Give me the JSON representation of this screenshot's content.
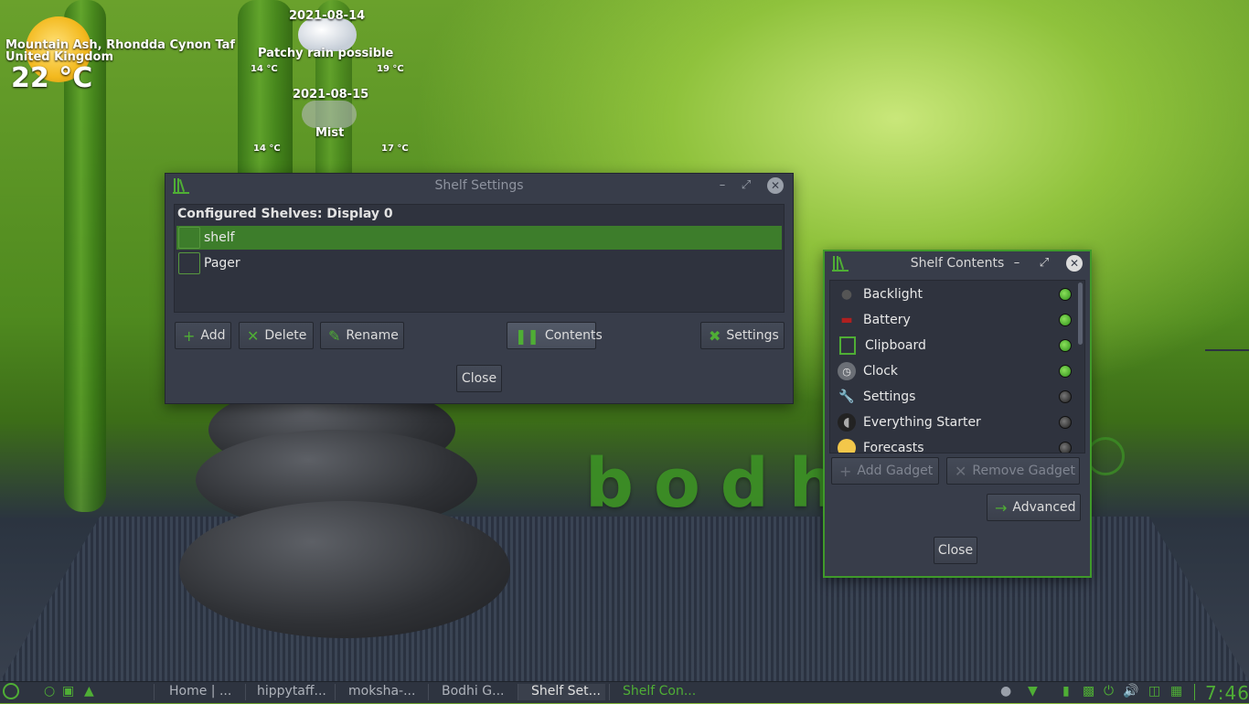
{
  "desktop": {
    "logo_text": "bodhi"
  },
  "weather": {
    "location_line1": "Mountain Ash, Rhondda Cynon Taf",
    "location_line2": "United Kingdom",
    "current_temp": "22 °C",
    "day1": {
      "date": "2021-08-14",
      "condition": "Patchy rain possible",
      "low": "14 °C",
      "high": "19 °C"
    },
    "day2": {
      "date": "2021-08-15",
      "condition": "Mist",
      "low": "14 °C",
      "high": "17 °C"
    }
  },
  "shelf_settings": {
    "title": "Shelf Settings",
    "heading": "Configured Shelves: Display 0",
    "shelves": [
      {
        "label": "shelf",
        "selected": true
      },
      {
        "label": "Pager",
        "selected": false
      }
    ],
    "buttons": {
      "add": "Add",
      "delete": "Delete",
      "rename": "Rename",
      "contents": "Contents",
      "settings": "Settings",
      "close": "Close"
    }
  },
  "shelf_contents": {
    "title": "Shelf Contents",
    "gadgets": [
      {
        "label": "Backlight",
        "icon": "bulb-icon",
        "enabled": true
      },
      {
        "label": "Battery",
        "icon": "battery-icon",
        "enabled": true
      },
      {
        "label": "Clipboard",
        "icon": "clipboard-icon",
        "enabled": true
      },
      {
        "label": "Clock",
        "icon": "clock-icon",
        "enabled": true
      },
      {
        "label": "Settings",
        "icon": "wrench-icon",
        "enabled": false
      },
      {
        "label": "Everything Starter",
        "icon": "everything-icon",
        "enabled": false
      },
      {
        "label": "Forecasts",
        "icon": "sun-icon",
        "enabled": false
      }
    ],
    "buttons": {
      "add_gadget": "Add Gadget",
      "remove_gadget": "Remove Gadget",
      "advanced": "Advanced",
      "close": "Close"
    }
  },
  "taskbar": {
    "tasks": [
      {
        "label": "Home | ..."
      },
      {
        "label": "hippytaff..."
      },
      {
        "label": "moksha-..."
      },
      {
        "label": "Bodhi G..."
      },
      {
        "label": "Shelf Set..."
      },
      {
        "label": "Shelf Con..."
      }
    ],
    "clock": "7:46"
  },
  "colors": {
    "accent": "#4fae35",
    "selection": "#3d7d2b",
    "window_bg": "#383d4a",
    "taskbar_bg": "#2e3440"
  }
}
